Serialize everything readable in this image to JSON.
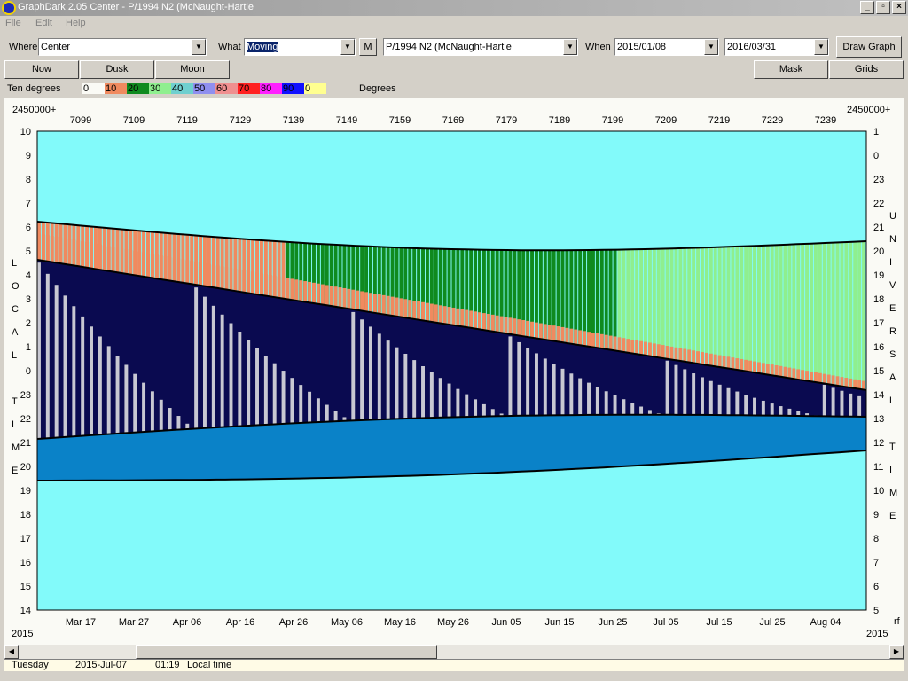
{
  "window": {
    "title": "GraphDark 2.05  Center  -  P/1994 N2 (McNaught-Hartle",
    "minimize": "_",
    "restore": "▫",
    "close": "×"
  },
  "menu": {
    "file": "File",
    "edit": "Edit",
    "help": "Help"
  },
  "toolbar": {
    "where_label": "Where",
    "where_value": "Center",
    "what_label": "What",
    "what_value": "Moving",
    "m_button": "M",
    "object_value": "P/1994 N2 (McNaught-Hartle",
    "when_label": "When",
    "date_from": "2015/01/08",
    "date_to": "2016/03/31",
    "draw_button": "Draw Graph"
  },
  "buttons": {
    "now": "Now",
    "dusk": "Dusk",
    "moon": "Moon",
    "mask": "Mask",
    "grids": "Grids"
  },
  "legend": {
    "label": "Ten degrees",
    "unit": "Degrees",
    "items": [
      {
        "text": "0",
        "color": "#fafaf5"
      },
      {
        "text": "10",
        "color": "#f08a5f"
      },
      {
        "text": "20",
        "color": "#0f8a1f"
      },
      {
        "text": "30",
        "color": "#8fef8f"
      },
      {
        "text": "40",
        "color": "#6fcfcf"
      },
      {
        "text": "50",
        "color": "#8f8fef"
      },
      {
        "text": "60",
        "color": "#ef8f8f"
      },
      {
        "text": "70",
        "color": "#ff2020"
      },
      {
        "text": "80",
        "color": "#ff20ff"
      },
      {
        "text": "90",
        "color": "#1010ff"
      },
      {
        "text": "0",
        "color": "#ffff90"
      }
    ]
  },
  "graph": {
    "jd_prefix_left": "2450000+",
    "jd_prefix_right": "2450000+",
    "jd_ticks": [
      "7099",
      "7109",
      "7119",
      "7129",
      "7139",
      "7149",
      "7159",
      "7169",
      "7179",
      "7189",
      "7199",
      "7209",
      "7219",
      "7229",
      "7239"
    ],
    "date_ticks": [
      "Mar 17",
      "Mar 27",
      "Apr 06",
      "Apr 16",
      "Apr 26",
      "May 06",
      "May 16",
      "May 26",
      "Jun 05",
      "Jun 15",
      "Jun 25",
      "Jul 05",
      "Jul 15",
      "Jul 25",
      "Aug 04"
    ],
    "left_hours": [
      "10",
      "9",
      "8",
      "7",
      "6",
      "5",
      "4",
      "3",
      "2",
      "1",
      "0",
      "23",
      "22",
      "21",
      "20",
      "19",
      "18",
      "17",
      "16",
      "15",
      "14"
    ],
    "right_hours": [
      "1",
      "0",
      "23",
      "22",
      "21",
      "20",
      "19",
      "18",
      "17",
      "16",
      "15",
      "14",
      "13",
      "12",
      "11",
      "10",
      "9",
      "8",
      "7",
      "6",
      "5"
    ],
    "left_axis_title": [
      "L",
      "O",
      "C",
      "A",
      "L",
      "",
      "T",
      "I",
      "M",
      "E"
    ],
    "right_axis_title": [
      "U",
      "N",
      "I",
      "V",
      "E",
      "R",
      "S",
      "A",
      "L",
      "",
      "T",
      "I",
      "M",
      "E"
    ],
    "year_left": "2015",
    "year_right": "2015",
    "corner_right": "rf",
    "colors": {
      "sky": "#82fafa",
      "twilight": "#0a82c8",
      "night": "#0a0a50",
      "moon": "#c8c8d2",
      "alt0": "#f08a5f",
      "alt10": "#0f8a1f",
      "alt20": "#8fef8f"
    }
  },
  "status": {
    "day": "Tuesday",
    "date": "2015-Jul-07",
    "time": "01:19",
    "zone": "Local time"
  }
}
